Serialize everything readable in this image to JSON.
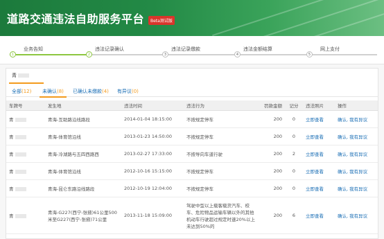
{
  "header": {
    "title": "道路交通违法自助服务平台",
    "badge": "Beta测试版"
  },
  "steps": [
    {
      "num": "1",
      "label": "业务告知"
    },
    {
      "num": "2",
      "label": "违法记录确认"
    },
    {
      "num": "3",
      "label": "违法记录缴款"
    },
    {
      "num": "4",
      "label": "违法金额结算"
    },
    {
      "num": "5",
      "label": "网上支付"
    }
  ],
  "plate_tab": "青",
  "filter_tabs": [
    {
      "label": "全部",
      "count": "(12)"
    },
    {
      "label": "未确认",
      "count": "(8)"
    },
    {
      "label": "已确认未缴款",
      "count": "(4)"
    },
    {
      "label": "有异议",
      "count": "(0)"
    }
  ],
  "table": {
    "headers": [
      "车牌号",
      "发生地",
      "违法时间",
      "违法行为",
      "罚款金额",
      "记分",
      "违法照片",
      "操作"
    ],
    "rows": [
      {
        "plate": "青",
        "place": "青海-互助路沿线路段",
        "time": "2014-01-04 18:15:00",
        "act": "不按规定停车",
        "fine": "200",
        "score": "0",
        "photo": "立即查看",
        "op1": "确认",
        "op2": "我有异议"
      },
      {
        "plate": "青",
        "place": "青海-体育馆沿线",
        "time": "2013-01-23 14:50:00",
        "act": "不按规定停车",
        "fine": "200",
        "score": "0",
        "photo": "立即查看",
        "op1": "确认",
        "op2": "我有异议"
      },
      {
        "plate": "青",
        "place": "青海-冷湖路与五四西路西",
        "time": "2013-02-27 17:33:00",
        "act": "不按导向车道行驶",
        "fine": "200",
        "score": "2",
        "photo": "立即查看",
        "op1": "确认",
        "op2": "我有异议"
      },
      {
        "plate": "青",
        "place": "青海-体育馆沿线",
        "time": "2012-10-16 15:15:00",
        "act": "不按规定停车",
        "fine": "200",
        "score": "0",
        "photo": "立即查看",
        "op1": "确认",
        "op2": "我有异议"
      },
      {
        "plate": "青",
        "place": "青海-昆仑东路沿线路段",
        "time": "2012-10-19 12:04:00",
        "act": "不按规定停车",
        "fine": "200",
        "score": "0",
        "photo": "立即查看",
        "op1": "确认",
        "op2": "我有异议"
      },
      {
        "plate": "青",
        "place": "青海-G227(西宁-张掖)61公里500米至G227(西宁-张掖)71公里",
        "time": "2013-11-18 15:09:00",
        "act": "驾驶中型以上载客载货汽车、校车、危险物品运输车辆以外的其他机动车行驶超过规定时速20%以上未达到50%的",
        "fine": "200",
        "score": "6",
        "photo": "立即查看",
        "op1": "确认",
        "op2": "我有异议"
      }
    ]
  },
  "colors": {
    "banner": "#238a46",
    "accent": "#f39a1c",
    "link": "#1a6eb5",
    "warn": "#d9352b",
    "progress": "#8cc63f"
  }
}
